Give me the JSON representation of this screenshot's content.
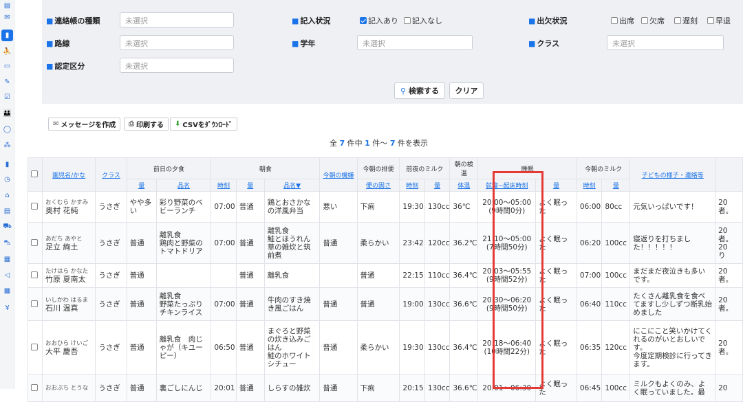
{
  "sidebar": {
    "icons": [
      "list-icon",
      "mail-icon",
      "notebook-icon",
      "walk-icon",
      "calendar-icon",
      "pen-icon",
      "check-icon",
      "family-icon",
      "chat-icon",
      "grid-icon",
      "document-icon",
      "clock-icon",
      "home-icon",
      "clipboard-icon",
      "car-icon",
      "cart-icon",
      "calendar2-icon",
      "send-icon",
      "grid2-icon",
      "yen-icon"
    ],
    "glyphs": [
      "▤",
      "✉",
      "▮",
      "⛹",
      "▭",
      "✎",
      "☑",
      "👪",
      "◯",
      "⁂",
      "▮",
      "◷",
      "⌂",
      "▤",
      "⛟",
      "⛍",
      "▦",
      "◁",
      "▦",
      "¥"
    ]
  },
  "search": {
    "type_label": "連絡帳の種類",
    "type_placeholder": "未選択",
    "status_label": "記入状況",
    "status_opt1": "記入あり",
    "status_opt2": "記入なし",
    "attend_label": "出欠状況",
    "attend_opts": [
      "出席",
      "欠席",
      "遅刻",
      "早退"
    ],
    "route_label": "路線",
    "route_placeholder": "未選択",
    "grade_label": "学年",
    "grade_placeholder": "未選択",
    "class_label": "クラス",
    "class_placeholder": "未選択",
    "cert_label": "認定区分",
    "cert_placeholder": "未選択",
    "search_button": "検索する",
    "clear_button": "クリア"
  },
  "toolbar": {
    "message_button": "メッセージを作成",
    "print_button": "印刷する",
    "csv_button": "CSVをﾀﾞｳﾝﾛｰﾄﾞ"
  },
  "summary": {
    "prefix": "全",
    "total": "7",
    "mid1": "件中",
    "from": "1",
    "mid2": "件～",
    "to": "7",
    "suffix": "件を表示"
  },
  "table": {
    "group_headers": {
      "dinner": "前日の夕食",
      "breakfast": "朝食",
      "stool": "今朝の排便",
      "night_milk": "前夜のミルク",
      "temp": "朝の検温",
      "sleep": "睡眠",
      "morning_milk": "今朝のミルク"
    },
    "headers": {
      "child_name": "園児名/かな",
      "class": "クラス",
      "mood": "今朝の機嫌",
      "notes": "子どもの様子・連絡等",
      "dinner_amount": "量",
      "dinner_menu": "品名",
      "bf_time": "時刻",
      "bf_amount": "量",
      "bf_menu": "品名▼",
      "stool_state": "便の固さ",
      "nm_time": "時刻",
      "nm_amount": "量",
      "temp_body": "体温",
      "sleep_time": "就寝~起床時刻",
      "sleep_amount": "量",
      "mm_time": "時刻",
      "mm_amount": "量"
    },
    "rows": [
      {
        "kana": "おくむら かすみ",
        "name": "奥村 花純",
        "class": "うさぎ",
        "d_amt": "やや多い",
        "d_menu": "彩り野菜のベビーランチ",
        "b_time": "07:00",
        "b_amt": "普通",
        "b_menu": "鶏とおさかなの洋風弁当",
        "mood": "悪い",
        "stool": "下痢",
        "nm_time": "19:30",
        "nm_amt": "130cc",
        "temp": "36℃",
        "sleep": "20:00～05:00",
        "sleep_dur": "(9時間0分)",
        "sleep_q": "よく眠った",
        "mm_time": "06:00",
        "mm_amt": "80cc",
        "notes": "元気いっぱいです！",
        "extra": "20\n者。"
      },
      {
        "kana": "あだち あやと",
        "name": "足立 絢土",
        "class": "うさぎ",
        "d_amt": "普通",
        "d_menu": "離乳食\n鶏肉と野菜のトマトドリア",
        "b_time": "07:00",
        "b_amt": "普通",
        "b_menu": "離乳食\n鮭とほうれん草の雑炊と筑前煮",
        "mood": "普通",
        "stool": "柔らかい",
        "nm_time": "23:42",
        "nm_amt": "120cc",
        "temp": "36.2℃",
        "sleep": "21:10～05:00",
        "sleep_dur": "(7時間50分)",
        "sleep_q": "よく眠った",
        "mm_time": "06:20",
        "mm_amt": "100cc",
        "notes": "寝返りを打ちました！！！！！",
        "extra": "20\n者。\n20\nり"
      },
      {
        "kana": "たけはら かなた",
        "name": "竹原 夏南太",
        "class": "うさぎ",
        "d_amt": "普通",
        "d_menu": "",
        "b_time": "",
        "b_amt": "普通",
        "b_menu": "離乳食",
        "mood": "",
        "stool": "普通",
        "nm_time": "22:15",
        "nm_amt": "110cc",
        "temp": "36.4℃",
        "sleep": "20:03～05:55",
        "sleep_dur": "(9時間52分)",
        "sleep_q": "よく眠った",
        "mm_time": "07:00",
        "mm_amt": "100cc",
        "notes": "まだまだ夜泣きも多いです。",
        "extra": "20\n者。"
      },
      {
        "kana": "いしかわ はるま",
        "name": "石川 温真",
        "class": "うさぎ",
        "d_amt": "普通",
        "d_menu": "離乳食\n野菜たっぷりチキンライス",
        "b_time": "07:00",
        "b_amt": "普通",
        "b_menu": "牛肉のすき焼き風ごはん",
        "mood": "普通",
        "stool": "普通",
        "nm_time": "19:00",
        "nm_amt": "130cc",
        "temp": "36.6℃",
        "sleep": "20:30～06:20",
        "sleep_dur": "(9時間50分)",
        "sleep_q": "よく眠った",
        "mm_time": "06:40",
        "mm_amt": "110cc",
        "notes": "たくさん離乳食を食べてますし少しずつ断乳始めました",
        "extra": "20\n者。"
      },
      {
        "kana": "おおひら けいご",
        "name": "大平 慶吾",
        "class": "うさぎ",
        "d_amt": "普通",
        "d_menu": "離乳食　肉じゃが（キユーピー）",
        "b_time": "06:50",
        "b_amt": "普通",
        "b_menu": "まぐろと野菜の炊き込みごはん\n鮭のホワイトシチュー",
        "mood": "普通",
        "stool": "柔らかい",
        "nm_time": "19:30",
        "nm_amt": "130cc",
        "temp": "36.4℃",
        "sleep": "20:18～06:40",
        "sleep_dur": "(10時間22分)",
        "sleep_q": "よく眠った",
        "mm_time": "06:35",
        "mm_amt": "120cc",
        "notes": "にこにこと笑いかけてくれるのがいとおしいです。\n今度定期検診に行ってきます。",
        "extra": "20\n者。"
      },
      {
        "kana": "おおぶち とうな",
        "name": "",
        "class": "うさぎ",
        "d_amt": "普通",
        "d_menu": "裏ごしにんじ",
        "b_time": "20:01",
        "b_amt": "普通",
        "b_menu": "しらすの雑炊",
        "mood": "普通",
        "stool": "下痢",
        "nm_time": "20:15",
        "nm_amt": "130cc",
        "temp": "36.6℃",
        "sleep": "20:01～06:30",
        "sleep_dur": "",
        "sleep_q": "よく眠った",
        "mm_time": "06:45",
        "mm_amt": "100cc",
        "notes": "ミルクもよくのみ、よく眠っていました。最",
        "extra": "20"
      }
    ]
  }
}
